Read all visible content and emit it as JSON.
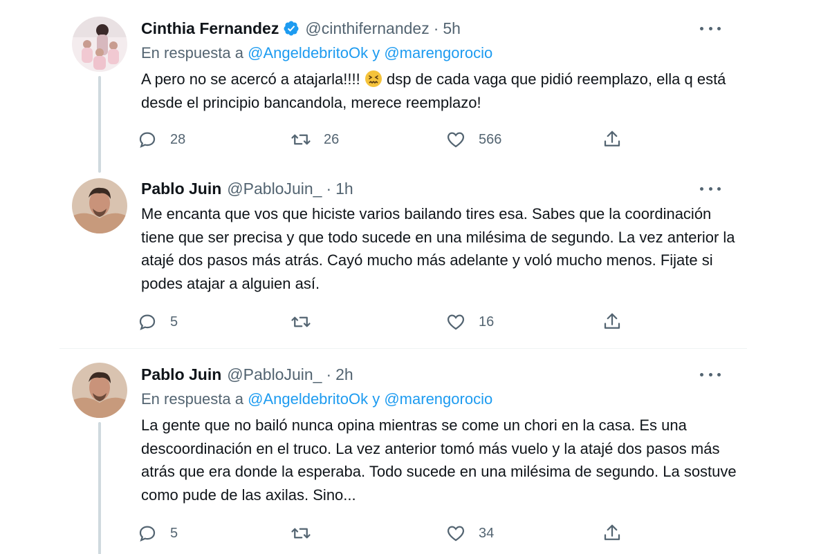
{
  "tweets": [
    {
      "name": "Cinthia Fernandez",
      "verified": true,
      "handle": "@cinthifernandez",
      "separator": "·",
      "time": "5h",
      "reply_prefix": "En respuesta a",
      "reply_user1": "@AngeldebritoOk",
      "reply_and": "y",
      "reply_user2": "@marengorocio",
      "text_part1": "A pero no se acercó a atajarla!!!! ",
      "emoji": "confounded-face",
      "text_part2": " dsp de cada vaga que pidió reemplazo, ella q está desde el principio bancandola, merece reemplazo!",
      "replies": "28",
      "retweets": "26",
      "likes": "566"
    },
    {
      "name": "Pablo Juin",
      "handle": "@PabloJuin_",
      "separator": "·",
      "time": "1h",
      "text": "Me encanta que vos que hiciste varios bailando tires esa. Sabes que la coordinación tiene que ser precisa y que todo sucede en una milésima de segundo. La vez anterior la atajé dos pasos más atrás. Cayó mucho más adelante y voló mucho menos. Fijate si podes atajar a alguien así.",
      "replies": "5",
      "retweets": "",
      "likes": "16"
    },
    {
      "name": "Pablo Juin",
      "handle": "@PabloJuin_",
      "separator": "·",
      "time": "2h",
      "reply_prefix": "En respuesta a",
      "reply_user1": "@AngeldebritoOk",
      "reply_and": "y",
      "reply_user2": "@marengorocio",
      "text": "La gente que no bailó nunca opina mientras se come un chori en la casa. Es una descoordinación en el truco. La vez anterior tomó más vuelo y la atajé dos pasos más atrás que era donde la esperaba. Todo sucede en una milésima de segundo. La sostuve como pude de las axilas. Sino...",
      "replies": "5",
      "retweets": "",
      "likes": "34"
    }
  ],
  "colors": {
    "accent": "#1d9bf0",
    "text_primary": "#0f1419",
    "text_secondary": "#536471",
    "thread_line": "#cfd9de"
  },
  "icons": {
    "reply": "reply-icon",
    "retweet": "retweet-icon",
    "like": "heart-icon",
    "share": "share-icon",
    "more": "more-options-icon",
    "verified": "verified-badge-icon"
  }
}
